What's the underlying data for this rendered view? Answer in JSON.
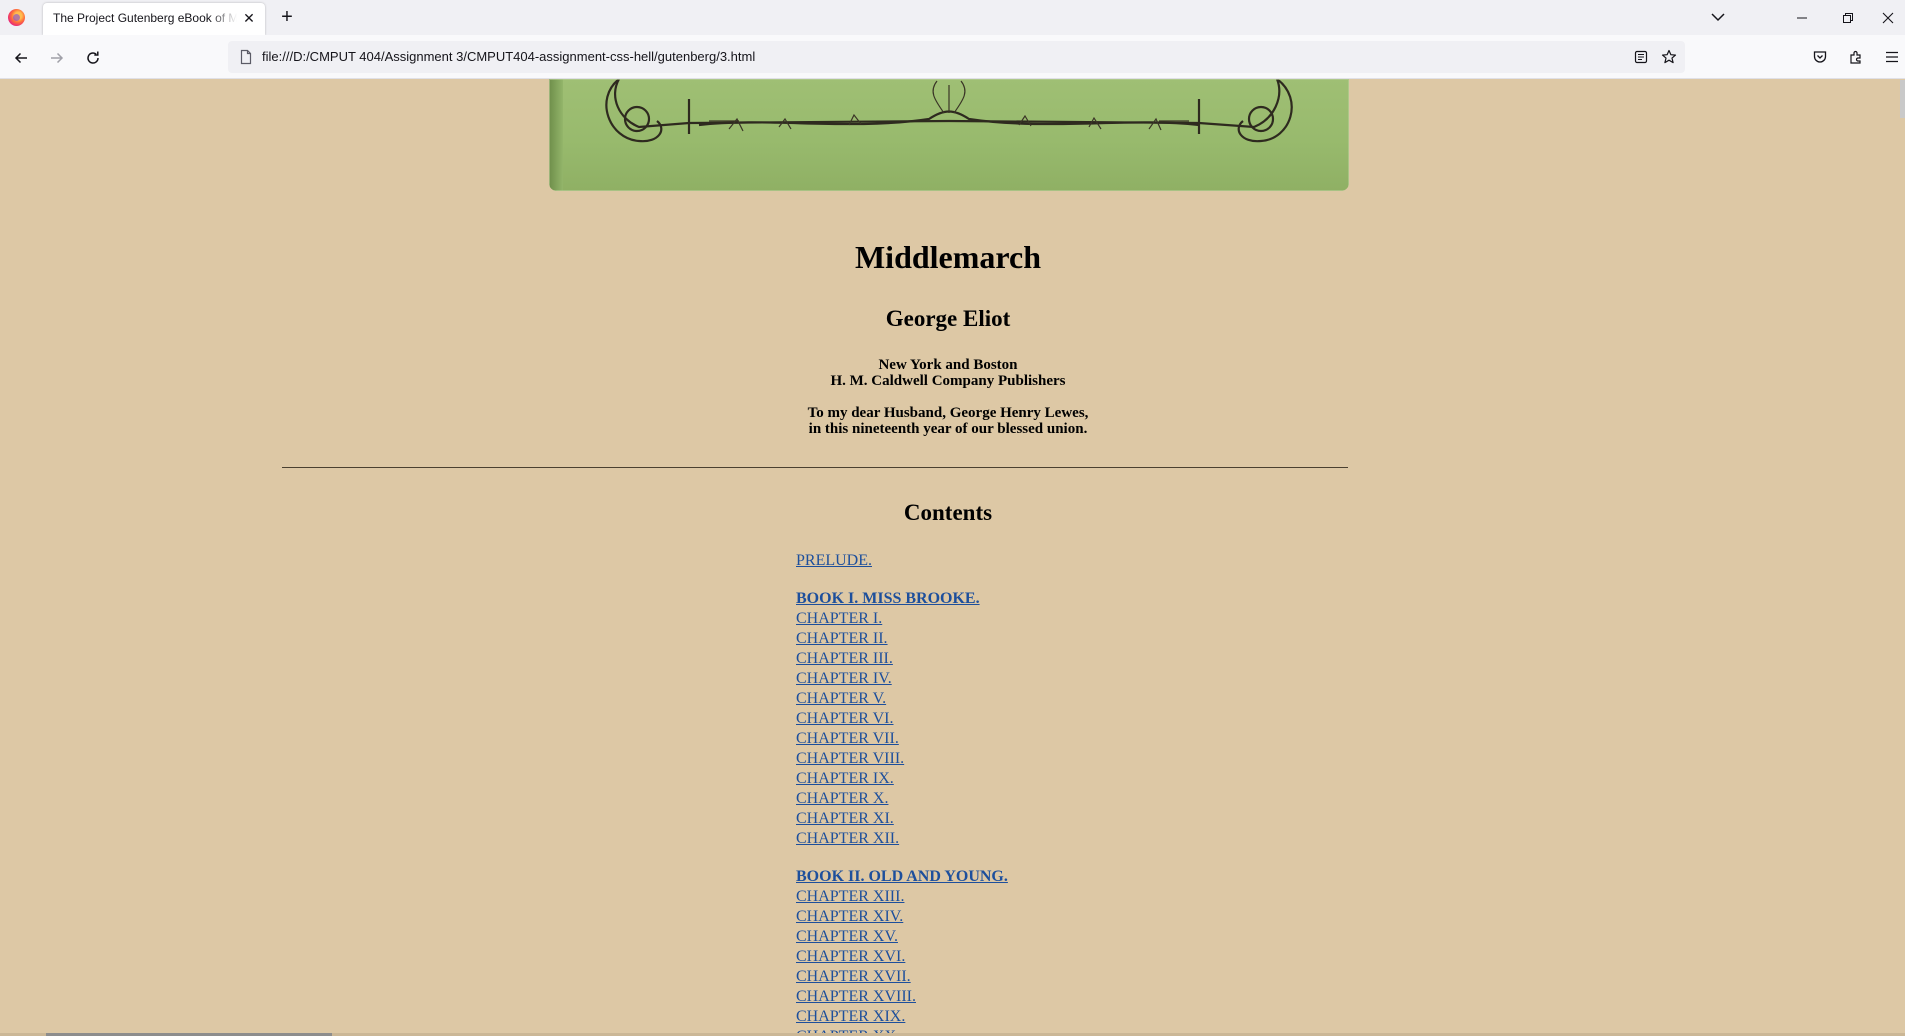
{
  "browser": {
    "tab_title": "The Project Gutenberg eBook of Middlemarch",
    "url": "file:///D:/CMPUT 404/Assignment 3/CMPUT404-assignment-css-hell/gutenberg/3.html"
  },
  "book": {
    "title": "Middlemarch",
    "author": "George Eliot",
    "publisher_line1": "New York and Boston",
    "publisher_line2": "H. M. Caldwell Company Publishers",
    "dedication_line1": "To my dear Husband, George Henry Lewes,",
    "dedication_line2": "in this nineteenth year of our blessed union."
  },
  "contents": {
    "heading": "Contents",
    "prelude": "PRELUDE.",
    "book1": {
      "title": "BOOK I. MISS BROOKE.",
      "chapters": [
        "CHAPTER I.",
        "CHAPTER II.",
        "CHAPTER III.",
        "CHAPTER IV.",
        "CHAPTER V.",
        "CHAPTER VI.",
        "CHAPTER VII.",
        "CHAPTER VIII.",
        "CHAPTER IX.",
        "CHAPTER X.",
        "CHAPTER XI.",
        "CHAPTER XII."
      ]
    },
    "book2": {
      "title": "BOOK II. OLD AND YOUNG.",
      "chapters": [
        "CHAPTER XIII.",
        "CHAPTER XIV.",
        "CHAPTER XV.",
        "CHAPTER XVI.",
        "CHAPTER XVII.",
        "CHAPTER XVIII.",
        "CHAPTER XIX.",
        "CHAPTER XX."
      ]
    }
  }
}
